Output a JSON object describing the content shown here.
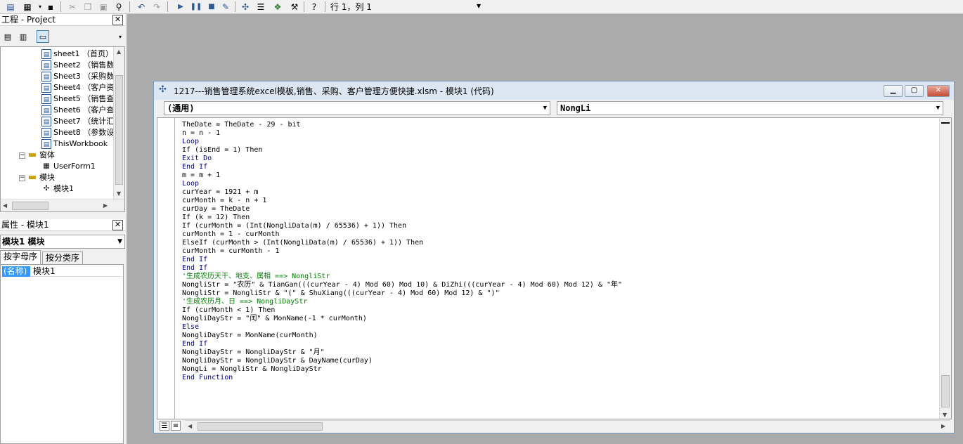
{
  "toolbar": {
    "icons": [
      "view-excel-icon",
      "insert-module-icon",
      "save-icon",
      "cut-icon",
      "copy-icon",
      "paste-icon",
      "find-icon",
      "undo-icon",
      "redo-icon",
      "run-icon",
      "break-icon",
      "reset-icon",
      "design-mode-icon",
      "project-explorer-icon",
      "properties-icon",
      "object-browser-icon",
      "toolbox-icon",
      "help-icon"
    ],
    "cursor_position": "行 1，列 1"
  },
  "project": {
    "title": "工程 - Project",
    "close": "✕",
    "tree": [
      {
        "label": "sheet1 （首页）",
        "type": "sheet"
      },
      {
        "label": "Sheet2 （销售数",
        "type": "sheet"
      },
      {
        "label": "Sheet3 （采购数",
        "type": "sheet"
      },
      {
        "label": "Sheet4 （客户资",
        "type": "sheet"
      },
      {
        "label": "Sheet5 （销售查",
        "type": "sheet"
      },
      {
        "label": "Sheet6 （客户查",
        "type": "sheet"
      },
      {
        "label": "Sheet7 （统计汇",
        "type": "sheet"
      },
      {
        "label": "Sheet8 （参数设",
        "type": "sheet"
      },
      {
        "label": "ThisWorkbook",
        "type": "sheet"
      },
      {
        "label": "窗体",
        "type": "folder"
      },
      {
        "label": "UserForm1",
        "type": "form"
      },
      {
        "label": "模块",
        "type": "folder"
      },
      {
        "label": "模块1",
        "type": "module"
      }
    ]
  },
  "properties": {
    "title": "属性 - 模块1",
    "close": "✕",
    "object": "模块1 模块",
    "tabs": [
      "按字母序",
      "按分类序"
    ],
    "row_name": "(名称)",
    "row_value": "模块1"
  },
  "code_window": {
    "title": "1217---销售管理系统excel模板,销售、采购、客户管理方便快捷.xlsm - 模块1 (代码)",
    "object_combo": "(通用)",
    "proc_combo": "NongLi",
    "lines": [
      "TheDate = TheDate - 29 - bit",
      "n = n - 1",
      "Loop",
      "If (isEnd = 1) Then",
      "Exit Do",
      "End If",
      "m = m + 1",
      "Loop",
      "curYear = 1921 + m",
      "curMonth = k - n + 1",
      "curDay = TheDate",
      "If (k = 12) Then",
      "If (curMonth = (Int(NongliData(m) / 65536) + 1)) Then",
      "curMonth = 1 - curMonth",
      "ElseIf (curMonth > (Int(NongliData(m) / 65536) + 1)) Then",
      "curMonth = curMonth - 1",
      "End If",
      "End If",
      "'生成农历天干、地支、属相 ==> NongliStr",
      "NongliStr = \"农历\" & TianGan(((curYear - 4) Mod 60) Mod 10) & DiZhi(((curYear - 4) Mod 60) Mod 12) & \"年\"",
      "NongliStr = NongliStr & \"(\" & ShuXiang(((curYear - 4) Mod 60) Mod 12) & \")\"",
      "'生成农历月、日 ==> NongliDayStr",
      "If (curMonth < 1) Then",
      "NongliDayStr = \"闰\" & MonName(-1 * curMonth)",
      "Else",
      "NongliDayStr = MonName(curMonth)",
      "End If",
      "NongliDayStr = NongliDayStr & \"月\"",
      "NongliDayStr = NongliDayStr & DayName(curDay)",
      "NongLi = NongliStr & NongliDayStr",
      "End Function"
    ]
  }
}
